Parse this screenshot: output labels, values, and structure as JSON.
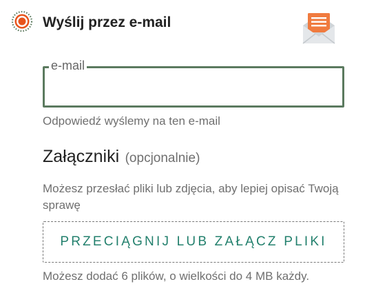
{
  "header": {
    "title": "Wyślij przez e-mail",
    "radio_selected": true,
    "accent_color": "#e8541c"
  },
  "email": {
    "label": "e-mail",
    "value": "",
    "placeholder": "",
    "hint": "Odpowiedź wyślemy na ten e-mail",
    "border_color": "#5b7a5f"
  },
  "attachments": {
    "title": "Załączniki",
    "optional_label": "(opcjonalnie)",
    "description": "Możesz przesłać pliki lub zdjęcia, aby lepiej opisać Twoją sprawę",
    "dropzone_label": "PRZECIĄGNIJ LUB ZAŁĄCZ PLIKI",
    "limit_hint": "Możesz dodać 6 plików, o wielkości do 4 MB każdy.",
    "dropzone_text_color": "#23806d"
  },
  "icons": {
    "radio": "radio-selected-icon",
    "mail": "envelope-open-icon"
  }
}
